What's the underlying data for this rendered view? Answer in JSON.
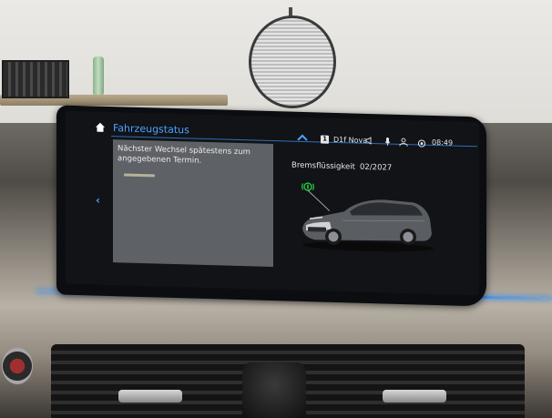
{
  "header": {
    "title": "Fahrzeugstatus",
    "network_badge": "1",
    "carrier": "D1f Nova",
    "time": "08:49"
  },
  "message_panel": {
    "text": "Nächster Wechsel spätestens zum angegebenen Termin."
  },
  "service_item": {
    "label": "Bremsflüssigkeit",
    "due_date": "02/2027"
  },
  "colors": {
    "accent": "#4aa3ff",
    "status_ok": "#27c93f",
    "panel_bg": "#5e6166",
    "screen_bg": "#111317"
  },
  "icons": {
    "home": "home-icon",
    "back": "chevron-left-icon",
    "collapse": "chevron-up-icon",
    "speaker": "speaker-icon",
    "microphone": "mic-icon",
    "user": "user-icon",
    "connected_drive": "connected-icon",
    "brake_warning": "brake-fluid-icon"
  }
}
